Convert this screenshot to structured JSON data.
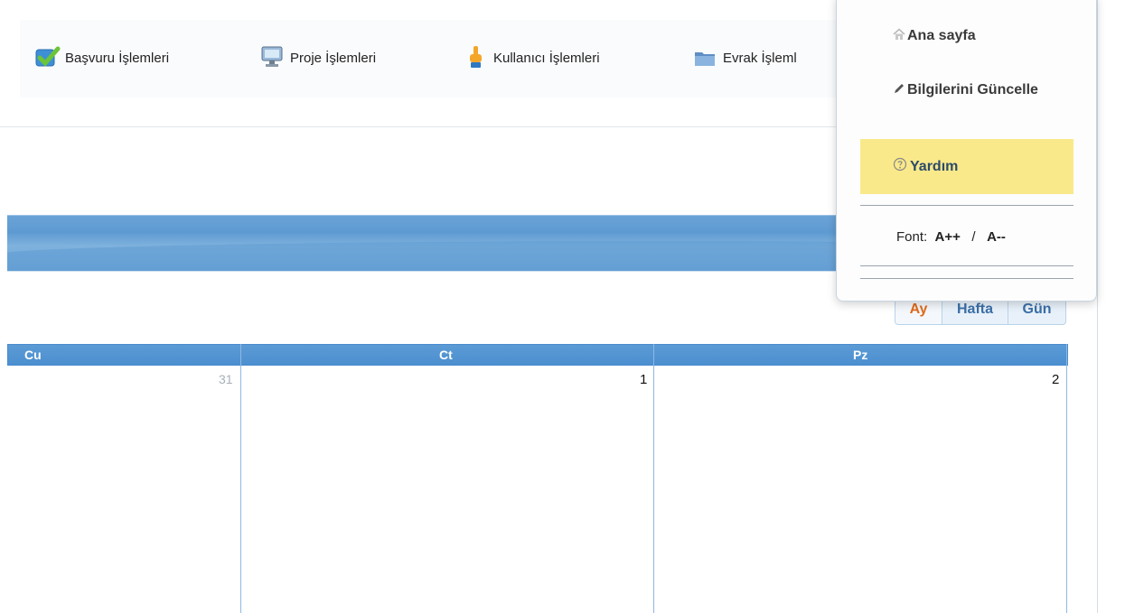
{
  "topnav": {
    "items": [
      {
        "label": "Başvuru İşlemleri",
        "icon": "check-icon"
      },
      {
        "label": "Proje İşlemleri",
        "icon": "monitor-icon"
      },
      {
        "label": "Kullanıcı İşlemleri",
        "icon": "hand-pointer-icon"
      },
      {
        "label": "Evrak İşleml",
        "icon": "folder-icon"
      }
    ]
  },
  "user_menu": {
    "items": [
      {
        "label": "Ana sayfa",
        "icon": "home-icon"
      },
      {
        "label": "Bilgilerini Güncelle",
        "icon": "pencil-icon"
      },
      {
        "label": "Yardım",
        "icon": "help-icon"
      }
    ],
    "font_label": "Font:",
    "font_increase": "A++",
    "font_separator": "/",
    "font_decrease": "A--",
    "highlight_color": "#fae98a"
  },
  "calendar": {
    "views": [
      "Ay",
      "Hafta",
      "Gün"
    ],
    "active_view": "Ay",
    "day_headers": [
      "Cu",
      "Ct",
      "Pz"
    ],
    "dates": [
      "31",
      "1",
      "2"
    ],
    "header_color": "#5b9bd5"
  }
}
